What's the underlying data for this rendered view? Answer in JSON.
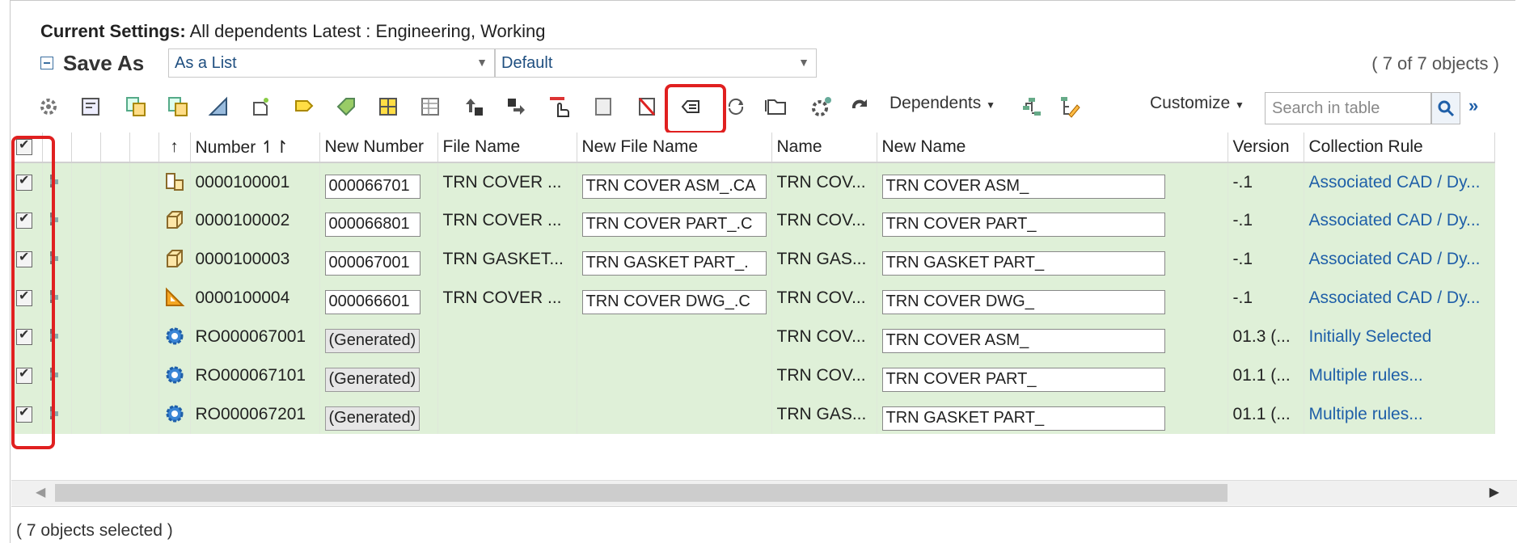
{
  "settings": {
    "label": "Current Settings:",
    "value": "All dependents Latest : Engineering, Working"
  },
  "saveas": {
    "title": "Save As",
    "view_select": "As a List",
    "filter_select": "Default",
    "count": "( 7 of 7 objects )"
  },
  "toolbar": {
    "dependents_label": "Dependents",
    "customize_label": "Customize",
    "search_placeholder": "Search in table",
    "more_label": "»"
  },
  "columns": {
    "sort_arrow": "↑",
    "number": "Number ↿↾",
    "new_number": "New Number",
    "file_name": "File Name",
    "new_file_name": "New File Name",
    "name": "Name",
    "new_name": "New Name",
    "version": "Version",
    "collection_rule": "Collection Rule"
  },
  "rows": [
    {
      "type_icon": "assembly-icon",
      "number": "0000100001",
      "new_number": "000066701",
      "file_name": "TRN COVER ...",
      "new_file_name": "TRN COVER ASM_.CA",
      "name": "TRN COV...",
      "new_name": "TRN COVER ASM_",
      "version": "-.1",
      "collection_rule": "Associated CAD / Dy..."
    },
    {
      "type_icon": "part-icon",
      "number": "0000100002",
      "new_number": "000066801",
      "file_name": "TRN COVER ...",
      "new_file_name": "TRN COVER PART_.C",
      "name": "TRN COV...",
      "new_name": "TRN COVER PART_",
      "version": "-.1",
      "collection_rule": "Associated CAD / Dy..."
    },
    {
      "type_icon": "part-icon",
      "number": "0000100003",
      "new_number": "000067001",
      "file_name": "TRN GASKET...",
      "new_file_name": "TRN GASKET PART_.",
      "name": "TRN GAS...",
      "new_name": "TRN GASKET PART_",
      "version": "-.1",
      "collection_rule": "Associated CAD / Dy..."
    },
    {
      "type_icon": "drawing-icon",
      "number": "0000100004",
      "new_number": "000066601",
      "file_name": "TRN COVER ...",
      "new_file_name": "TRN COVER DWG_.C",
      "name": "TRN COV...",
      "new_name": "TRN COVER DWG_",
      "version": "-.1",
      "collection_rule": "Associated CAD / Dy..."
    },
    {
      "type_icon": "gear-icon",
      "number": "RO000067001",
      "new_number": "(Generated)",
      "file_name": "",
      "new_file_name": "",
      "name": "TRN COV...",
      "new_name": "TRN COVER ASM_",
      "version": "01.3 (...",
      "collection_rule": "Initially Selected"
    },
    {
      "type_icon": "gear-icon",
      "number": "RO000067101",
      "new_number": "(Generated)",
      "file_name": "",
      "new_file_name": "",
      "name": "TRN COV...",
      "new_name": "TRN COVER PART_",
      "version": "01.1 (...",
      "collection_rule": "Multiple rules..."
    },
    {
      "type_icon": "gear-icon",
      "number": "RO000067201",
      "new_number": "(Generated)",
      "file_name": "",
      "new_file_name": "",
      "name": "TRN GAS...",
      "new_name": "TRN GASKET PART_",
      "version": "01.1 (...",
      "collection_rule": "Multiple rules..."
    }
  ],
  "footer": {
    "selected": "( 7 objects selected )"
  },
  "colors": {
    "row_bg": "#dff0d8",
    "link": "#1f5fa8",
    "highlight": "#e02020"
  }
}
